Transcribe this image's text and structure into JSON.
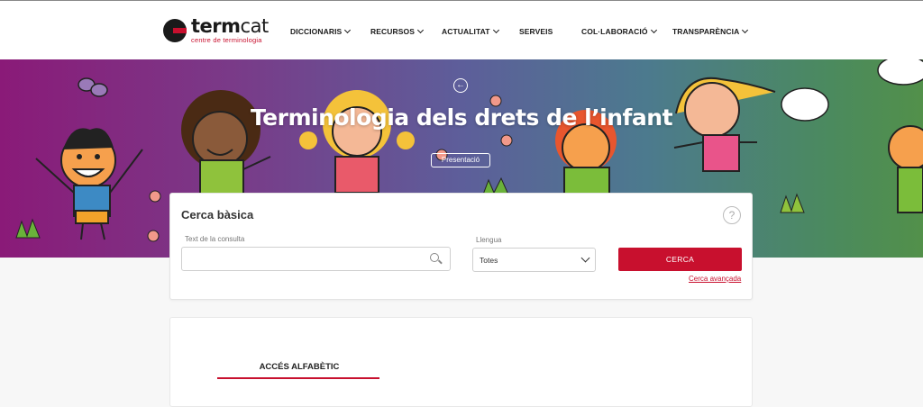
{
  "brand": {
    "name_bold": "term",
    "name_regular": "cat",
    "tagline": "centre de terminologia",
    "accent": "#c8102e"
  },
  "nav": {
    "items": [
      {
        "label": "DICCIONARIS",
        "dropdown": true
      },
      {
        "label": "RECURSOS",
        "dropdown": true
      },
      {
        "label": "ACTUALITAT",
        "dropdown": true
      },
      {
        "label": "SERVEIS",
        "dropdown": false
      },
      {
        "label": "COL·LABORACIÓ",
        "dropdown": true
      },
      {
        "label": "TRANSPARÈNCIA",
        "dropdown": true
      }
    ]
  },
  "hero": {
    "title": "Terminologia dels drets de l’infant",
    "presentation_label": "Presentació",
    "back_icon": "arrow-left-circle-icon"
  },
  "search": {
    "title": "Cerca bàsica",
    "help_glyph": "?",
    "query_label": "Text de la consulta",
    "query_value": "",
    "language_label": "Llengua",
    "language_value": "Totes",
    "submit_label": "CERCA",
    "advanced_link": "Cerca avançada"
  },
  "alphabetic": {
    "tab_label": "ACCÉS ALFABÈTIC"
  }
}
